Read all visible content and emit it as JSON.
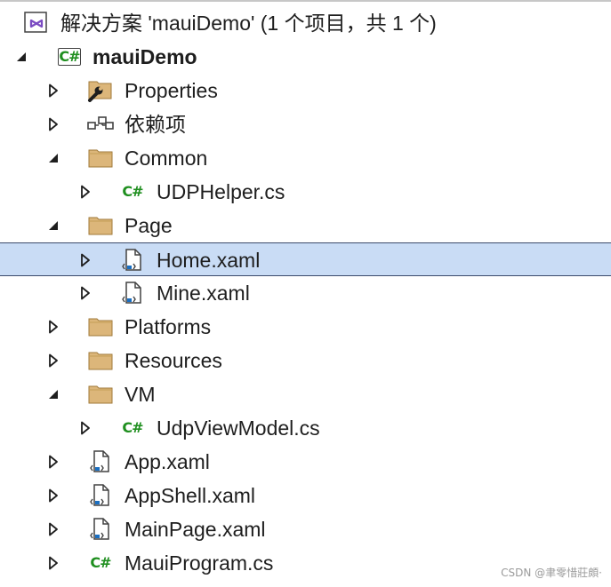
{
  "solution": {
    "label": "解决方案 'mauiDemo' (1 个项目，共 1 个)"
  },
  "project": {
    "label": "mauiDemo",
    "badge": "C#"
  },
  "items": [
    {
      "label": "Properties"
    },
    {
      "label": "依赖项"
    },
    {
      "label": "Common"
    },
    {
      "label": "UDPHelper.cs",
      "badge": "C#"
    },
    {
      "label": "Page"
    },
    {
      "label": "Home.xaml"
    },
    {
      "label": "Mine.xaml"
    },
    {
      "label": "Platforms"
    },
    {
      "label": "Resources"
    },
    {
      "label": "VM"
    },
    {
      "label": "UdpViewModel.cs",
      "badge": "C#"
    },
    {
      "label": "App.xaml"
    },
    {
      "label": "AppShell.xaml"
    },
    {
      "label": "MainPage.xaml"
    },
    {
      "label": "MauiProgram.cs",
      "badge": "C#"
    }
  ],
  "watermark": "CSDN @聿零惜莊頗·",
  "colors": {
    "selection": "#c9dcf5",
    "selection_border": "#3b4a6b",
    "folder": "#dcb67a",
    "csharp": "#1f8f1f",
    "xaml_accent": "#1a6fc2"
  }
}
